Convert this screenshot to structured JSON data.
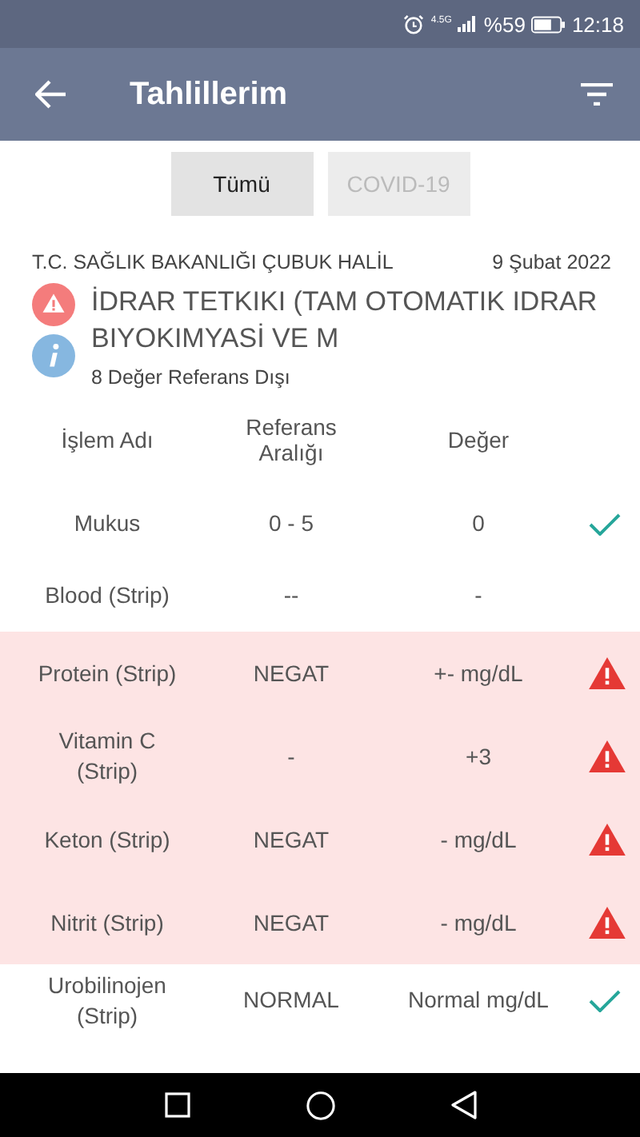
{
  "status_bar": {
    "network": "4.5G",
    "battery": "%59",
    "time": "12:18"
  },
  "app_bar": {
    "title": "Tahlillerim"
  },
  "tabs": [
    {
      "label": "Tümü",
      "selected": true
    },
    {
      "label": "COVID-19",
      "selected": false
    }
  ],
  "test": {
    "source": "T.C. SAĞLIK BAKANLIĞI ÇUBUK HALİL",
    "date": "9 Şubat 2022",
    "title": "İDRAR TETKIKI (TAM OTOMATIK IDRAR BIYOKIMYASİ VE M",
    "summary": "8 Değer Referans Dışı"
  },
  "table": {
    "columns": [
      "İşlem Adı",
      "Referans Aralığı",
      "Değer"
    ],
    "rows": [
      {
        "name": "Mukus",
        "reference": "0 - 5",
        "value": "0",
        "kind": "ok"
      },
      {
        "name": "Blood (Strip)",
        "reference": "--",
        "value": "-",
        "kind": "none"
      },
      {
        "name": "Protein  (Strip)",
        "reference": "NEGAT",
        "value": "+- mg/dL",
        "kind": "out"
      },
      {
        "name": "Vitamin C (Strip)",
        "reference": "-",
        "value": "+3",
        "kind": "out"
      },
      {
        "name": "Keton  (Strip)",
        "reference": "NEGAT",
        "value": "- mg/dL",
        "kind": "out"
      },
      {
        "name": "Nitrit  (Strip)",
        "reference": "NEGAT",
        "value": "- mg/dL",
        "kind": "out"
      },
      {
        "name": "Urobilinojen (Strip)",
        "reference": "NORMAL",
        "value": "Normal mg/dL",
        "kind": "ok"
      }
    ]
  }
}
